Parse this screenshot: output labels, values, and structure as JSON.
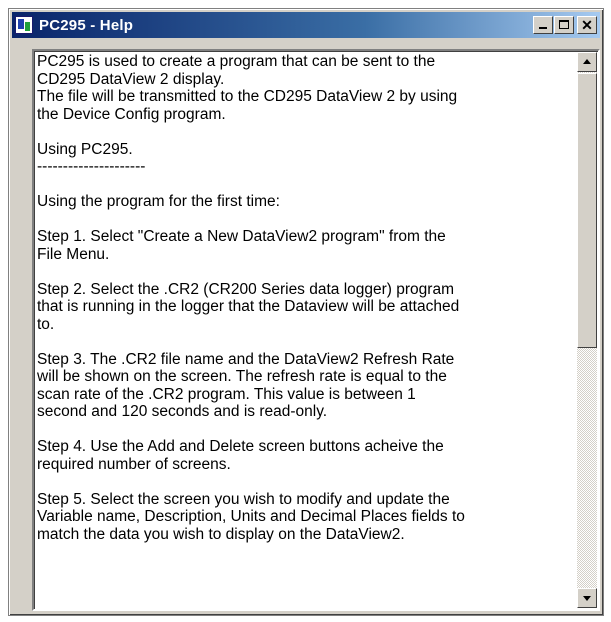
{
  "window": {
    "title": "PC295 - Help",
    "icon": "app-icon",
    "buttons": {
      "minimize": "minimize-icon",
      "maximize": "maximize-icon",
      "close": "close-icon"
    }
  },
  "help": {
    "paragraphs": [
      "PC295 is used to create a program that can be sent to the\nCD295 DataView 2 display.\nThe file will be transmitted to the CD295 DataView 2 by using\nthe Device Config program.",
      "Using PC295.\n---------------------",
      "Using the program for the first time:",
      "Step 1. Select \"Create a New DataView2 program\" from the\nFile Menu.",
      "Step 2. Select the .CR2 (CR200 Series data logger) program\nthat is running in the logger that the Dataview will be attached\nto.",
      "Step 3. The .CR2 file name and the DataView2 Refresh Rate\nwill be shown on the screen. The refresh rate is equal to the\nscan rate of the .CR2 program. This value is between 1\nsecond and 120 seconds and is read-only.",
      "Step 4. Use the Add and Delete screen buttons acheive the\nrequired number of screens.",
      "Step 5. Select the screen you wish to modify and update the\nVariable name, Description, Units and Decimal Places fields to\nmatch the data you wish to display on the DataView2."
    ]
  },
  "scrollbar": {
    "position": 0.0
  },
  "colors": {
    "titlebar_start": "#0a246a",
    "titlebar_end": "#a6caf0",
    "face": "#d4d0c8"
  }
}
